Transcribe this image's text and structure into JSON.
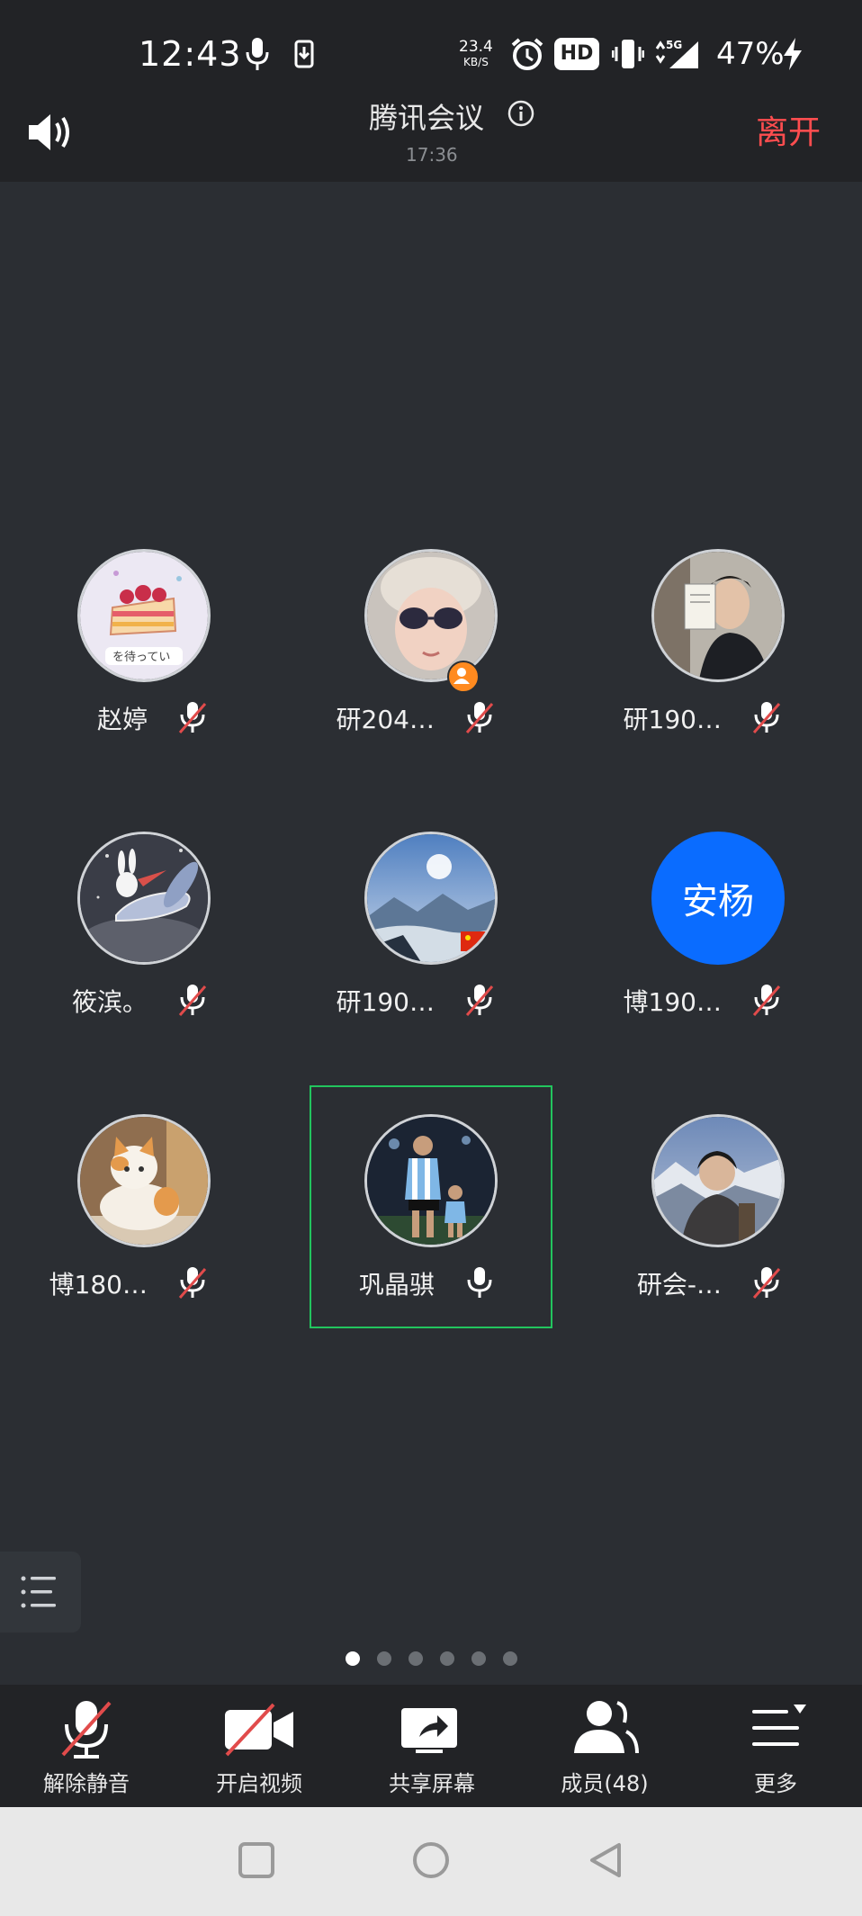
{
  "status_bar": {
    "time": "12:43",
    "net_speed_value": "23.4",
    "net_speed_unit": "KB/S",
    "hd_label": "HD",
    "network_label": "5G",
    "battery": "47%"
  },
  "header": {
    "title": "腾讯会议",
    "elapsed": "17:36",
    "leave_label": "离开"
  },
  "participants": [
    {
      "name": "赵婷",
      "muted": true,
      "avatar": "cake-photo",
      "avatar_caption": "を待ってい"
    },
    {
      "name": "研204…",
      "muted": true,
      "avatar": "sunglasses-photo",
      "host": true
    },
    {
      "name": "研190…",
      "muted": true,
      "avatar": "book-portrait-photo"
    },
    {
      "name": "筱滨。",
      "muted": true,
      "avatar": "rabbit-rocket-drawing"
    },
    {
      "name": "研190…",
      "muted": true,
      "avatar": "mountain-clouds-photo"
    },
    {
      "name": "博190…",
      "muted": true,
      "avatar_text": "安杨",
      "avatar_color": "#0a6cff"
    },
    {
      "name": "博180…",
      "muted": true,
      "avatar": "cat-photo"
    },
    {
      "name": "巩晶骐",
      "muted": false,
      "speaking": true,
      "avatar": "soccer-player-photo"
    },
    {
      "name": "研会-…",
      "muted": true,
      "avatar": "mountain-portrait-photo"
    }
  ],
  "pagination": {
    "total": 6,
    "current": 1
  },
  "toolbar": {
    "unmute_label": "解除静音",
    "video_label": "开启视频",
    "share_label": "共享屏幕",
    "members_label": "成员(48)",
    "more_label": "更多"
  },
  "colors": {
    "background": "#2b2e33",
    "bar": "#222326",
    "leave": "#ff4d4f",
    "speaking_frame": "#22c55e",
    "muted_slash": "#e14b4b",
    "text_avatar": "#0a6cff"
  }
}
